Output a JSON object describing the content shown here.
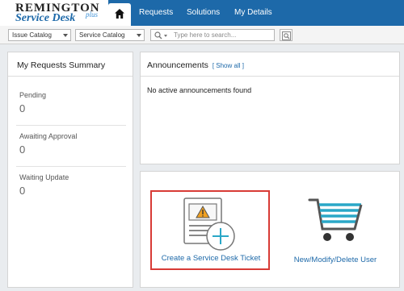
{
  "logo": {
    "main": "REMINGTON",
    "sub": "Service Desk",
    "plus": "plus"
  },
  "nav": {
    "home_icon": "home-icon",
    "items": [
      {
        "label": "Requests"
      },
      {
        "label": "Solutions"
      },
      {
        "label": "My Details"
      }
    ]
  },
  "toolbar": {
    "issue_catalog": "Issue Catalog",
    "service_catalog": "Service Catalog",
    "search_placeholder": "Type here to search...",
    "search_icon": "search-icon",
    "advanced_search_icon": "advanced-search-icon"
  },
  "summary": {
    "title": "My Requests Summary",
    "stats": [
      {
        "label": "Pending",
        "value": "0"
      },
      {
        "label": "Awaiting Approval",
        "value": "0"
      },
      {
        "label": "Waiting Update",
        "value": "0"
      }
    ]
  },
  "announcements": {
    "title": "Announcements",
    "show_all": "[ Show all ]",
    "empty_message": "No active announcements found"
  },
  "actions": {
    "create_ticket": {
      "label": "Create a Service Desk Ticket",
      "icon": "create-ticket-icon"
    },
    "manage_user": {
      "label": "New/Modify/Delete User",
      "icon": "shopping-cart-icon"
    }
  },
  "colors": {
    "brand_blue": "#1d69a9",
    "highlight_red": "#d83b36",
    "warning_orange": "#f0a020",
    "cart_teal": "#2aa7c7"
  }
}
